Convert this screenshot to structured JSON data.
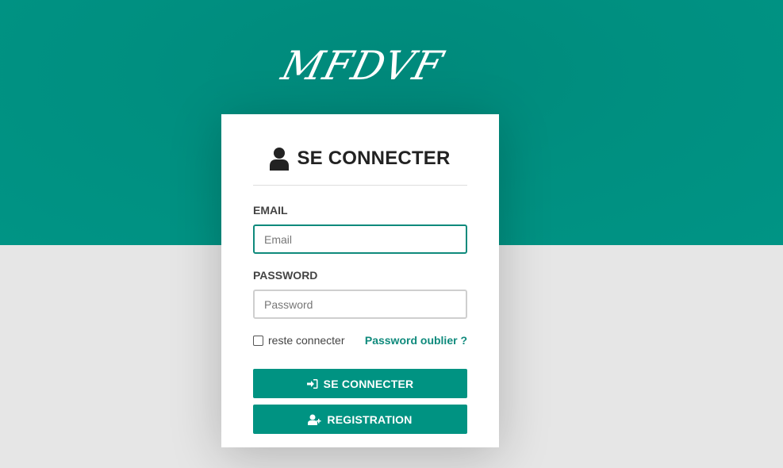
{
  "brand": {
    "logo_text": "MFDVF",
    "primary_color": "#009382"
  },
  "login_card": {
    "title": "SE CONNECTER",
    "title_icon": "user-icon",
    "email": {
      "label": "EMAIL",
      "placeholder": "Email",
      "value": ""
    },
    "password": {
      "label": "PASSWORD",
      "placeholder": "Password",
      "value": ""
    },
    "remember_label": "reste connecter",
    "forgot_password_link": "Password oublier ?",
    "login_button": {
      "label": "SE CONNECTER",
      "icon": "sign-in-icon"
    },
    "register_button": {
      "label": "REGISTRATION",
      "icon": "user-plus-icon"
    }
  }
}
